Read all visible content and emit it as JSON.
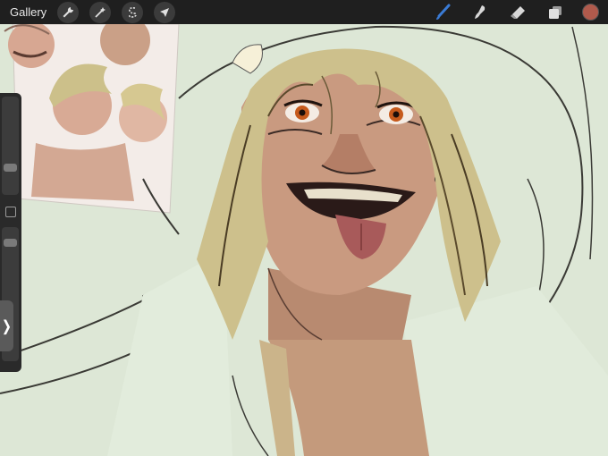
{
  "toolbar": {
    "gallery_label": "Gallery",
    "left_icons": [
      "wrench-icon",
      "magic-wand-icon",
      "selection-icon",
      "transform-arrow-icon"
    ],
    "right_icons": [
      "brush-icon",
      "smudge-icon",
      "eraser-icon",
      "layers-icon"
    ],
    "active_tool": "brush-icon",
    "current_color": "#b05a4c",
    "active_color": "#3a7bd5"
  },
  "sidebar": {
    "brush_size_level": 0.25,
    "opacity_level": 0.92,
    "handle_glyph": "❭"
  }
}
